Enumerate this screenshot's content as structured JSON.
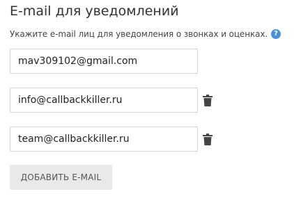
{
  "section": {
    "title": "E-mail для уведомлений",
    "hint": "Укажите e-mail лиц для уведомления о звонках и оценках.",
    "help_icon": "question-circle-icon",
    "help_glyph": "?"
  },
  "emails": [
    {
      "value": "mav309102@gmail.com",
      "deletable": false
    },
    {
      "value": "info@callbackkiller.ru",
      "deletable": true
    },
    {
      "value": "team@callbackkiller.ru",
      "deletable": true
    }
  ],
  "actions": {
    "add_label": "ДОБАВИТЬ E-MAIL",
    "delete_icon": "trash-icon"
  },
  "colors": {
    "accent": "#4a90d9",
    "icon": "#444444",
    "button_bg": "#e9e9e9"
  }
}
